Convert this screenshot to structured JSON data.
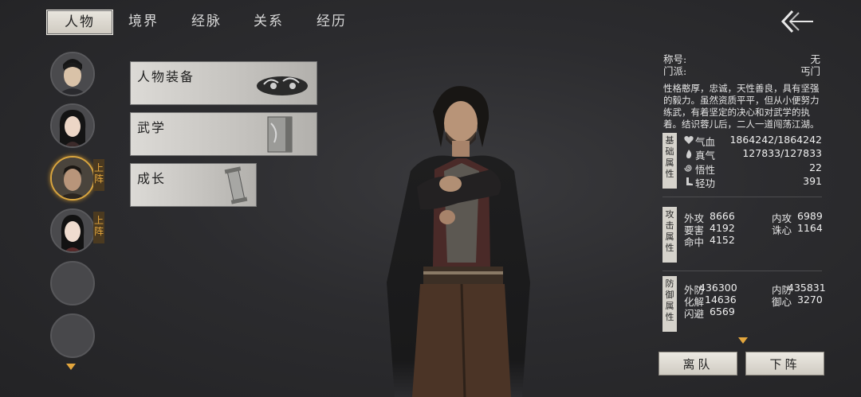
{
  "tabs": [
    {
      "label": "人物",
      "active": true
    },
    {
      "label": "境界",
      "active": false
    },
    {
      "label": "经脉",
      "active": false
    },
    {
      "label": "关系",
      "active": false
    },
    {
      "label": "经历",
      "active": false
    }
  ],
  "roster": {
    "badges": [
      "上阵",
      "上阵"
    ]
  },
  "menu": {
    "equipment": "人物装备",
    "martial": "武学",
    "growth": "成长"
  },
  "profile": {
    "title_label": "称号:",
    "title_value": "无",
    "sect_label": "门派:",
    "sect_value": "丐门",
    "description": "性格憨厚，忠诚，天性善良，具有坚强的毅力。虽然资质平平，但从小便努力练武，有着坚定的决心和对武学的执着。结识蓉儿后，二人一道闯荡江湖。"
  },
  "basic": {
    "tag": "基础属性",
    "hp_label": "气血",
    "hp_value": "1864242/1864242",
    "qi_label": "真气",
    "qi_value": "127833/127833",
    "wisdom_label": "悟性",
    "wisdom_value": "22",
    "agility_label": "轻功",
    "agility_value": "391"
  },
  "attack": {
    "tag": "攻击属性",
    "outer_label": "外攻",
    "outer_value": "8666",
    "inner_label": "内攻",
    "inner_value": "6989",
    "vital_label": "要害",
    "vital_value": "4192",
    "heart_label": "诛心",
    "heart_value": "1164",
    "hit_label": "命中",
    "hit_value": "4152"
  },
  "defense": {
    "tag": "防御属性",
    "outer_label": "外防",
    "outer_value": "436300",
    "inner_label": "内防",
    "inner_value": "435831",
    "resolve_label": "化解",
    "resolve_value": "14636",
    "guard_label": "御心",
    "guard_value": "3270",
    "dodge_label": "闪避",
    "dodge_value": "6569"
  },
  "actions": {
    "leave": "离队",
    "bench": "下阵"
  },
  "colors": {
    "accent_gold": "#d9a53f",
    "button_light": "#e9e6df",
    "background": "#2c2c2f"
  }
}
